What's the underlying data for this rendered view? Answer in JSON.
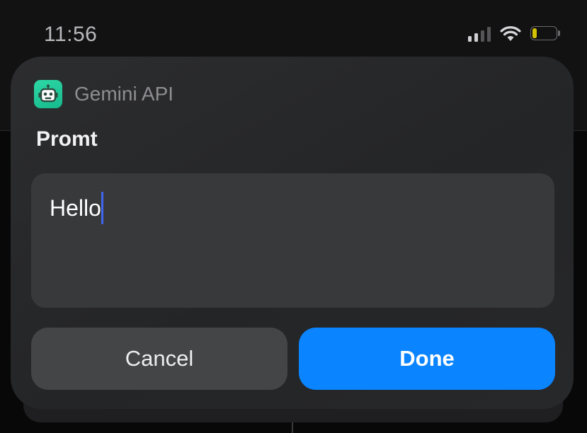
{
  "status_bar": {
    "time": "11:56",
    "signal_bars_active": 2,
    "signal_bars_total": 4,
    "battery_level_fraction": 0.2,
    "battery_color": "#d4c100"
  },
  "dialog": {
    "app_name": "Gemini API",
    "app_icon": "robot-icon",
    "app_icon_color": "#1fc896",
    "title": "Promt",
    "input_value": "Hello",
    "cancel_label": "Cancel",
    "done_label": "Done",
    "accent_color": "#0a84ff",
    "cursor_color": "#3f66f0"
  }
}
